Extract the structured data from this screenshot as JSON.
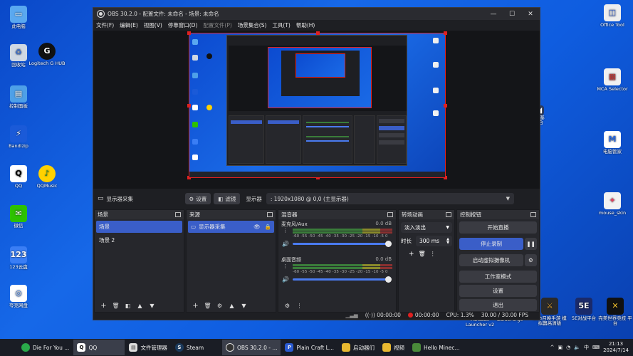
{
  "desktop": {
    "left_icons": [
      {
        "label": "此电脑",
        "icon": "computer-icon"
      },
      {
        "label": "回收站",
        "icon": "recycle-bin-icon"
      },
      {
        "label": "控制面板",
        "icon": "control-panel-icon"
      },
      {
        "label": "Bandizip",
        "icon": "bandizip-icon"
      },
      {
        "label": "QQ",
        "icon": "qq-icon"
      },
      {
        "label": "微信",
        "icon": "wechat-icon"
      },
      {
        "label": "123云盘",
        "icon": "cloud-drive-icon"
      },
      {
        "label": "夸克网盘",
        "icon": "quark-drive-icon"
      }
    ],
    "second_col_icons": [
      {
        "label": "Logitech G HUB",
        "icon": "logitech-icon"
      },
      {
        "label": "QQMusic",
        "icon": "qqmusic-icon"
      }
    ],
    "right_icons": [
      {
        "label": "Office Tool",
        "icon": "office-tool-icon"
      },
      {
        "label": "MCA Selector",
        "icon": "mca-selector-icon"
      },
      {
        "label": "电脑管家",
        "icon": "pc-manager-icon"
      },
      {
        "label": "mouse_skin",
        "icon": "mouse-skin-icon"
      }
    ],
    "partial_right_label": "i调基\n盒合",
    "bottom_right_icons": [
      {
        "label": "Paradox Launcher v2",
        "icon": "paradox-icon"
      },
      {
        "label": "CurseForge",
        "icon": "curseforge-icon"
      },
      {
        "label": "使命召唤手游 模拟器高清版",
        "icon": "cod-icon"
      },
      {
        "label": "5E对战平台",
        "icon": "5e-icon"
      },
      {
        "label": "完美世界竞技 平台",
        "icon": "perfect-world-icon"
      }
    ]
  },
  "obs": {
    "title": "OBS 30.2.0 - 配置文件: 未命名 - 场景: 未命名",
    "menu": [
      "文件(F)",
      "编辑(E)",
      "视图(V)",
      "停靠窗口(D)",
      "配置文件(P)",
      "场景集合(S)",
      "工具(T)",
      "帮助(H)"
    ],
    "toolbar": {
      "source_name": "显示器采集",
      "settings_label": "设置",
      "filters_label": "滤镜",
      "display_label": "显示器",
      "display_value": ": 1920x1080 @ 0,0 (主显示器)"
    },
    "scenes": {
      "title": "场景",
      "items": [
        "场景",
        "场景 2"
      ]
    },
    "sources": {
      "title": "来源",
      "items": [
        "显示器采集"
      ]
    },
    "mixer": {
      "title": "混音器",
      "channels": [
        {
          "name": "麦克风/Aux",
          "db": "0.0 dB"
        },
        {
          "name": "桌面音频",
          "db": "0.0 dB"
        }
      ],
      "scale": "-60 -55 -50 -45 -40 -35 -30 -25 -20 -15 -10 -5 0"
    },
    "transitions": {
      "title": "转场动画",
      "type": "淡入淡出",
      "duration_label": "时长",
      "duration_value": "300 ms"
    },
    "controls": {
      "title": "控制按钮",
      "buttons": [
        "开始直播",
        "停止录制",
        "启动虚拟摄像机",
        "工作室模式",
        "设置",
        "退出"
      ]
    },
    "status": {
      "stream_time": "00:00:00",
      "rec_time": "00:00:00",
      "cpu": "CPU: 1.3%",
      "fps": "30.00 / 30.00 FPS"
    }
  },
  "taskbar": {
    "items": [
      {
        "label": "Die For You ...",
        "icon": "chrome-icon"
      },
      {
        "label": "QQ",
        "icon": "qq-icon"
      },
      {
        "label": "文件管理器",
        "icon": "file-manager-icon"
      },
      {
        "label": "Steam",
        "icon": "steam-icon"
      },
      {
        "label": "OBS 30.2.0 - ...",
        "icon": "obs-icon"
      },
      {
        "label": "Plain Craft L...",
        "icon": "pcl-icon"
      },
      {
        "label": "启动器们",
        "icon": "folder-icon"
      },
      {
        "label": "视频",
        "icon": "folder-icon"
      },
      {
        "label": "Hello Minec...",
        "icon": "chrome-icon"
      }
    ],
    "lang": "中",
    "time": "21:13",
    "date": "2024/7/14"
  },
  "colors": {
    "accent": "#3a5ec8",
    "record_red": "#e02020",
    "obs_bg": "#1e1f23"
  }
}
